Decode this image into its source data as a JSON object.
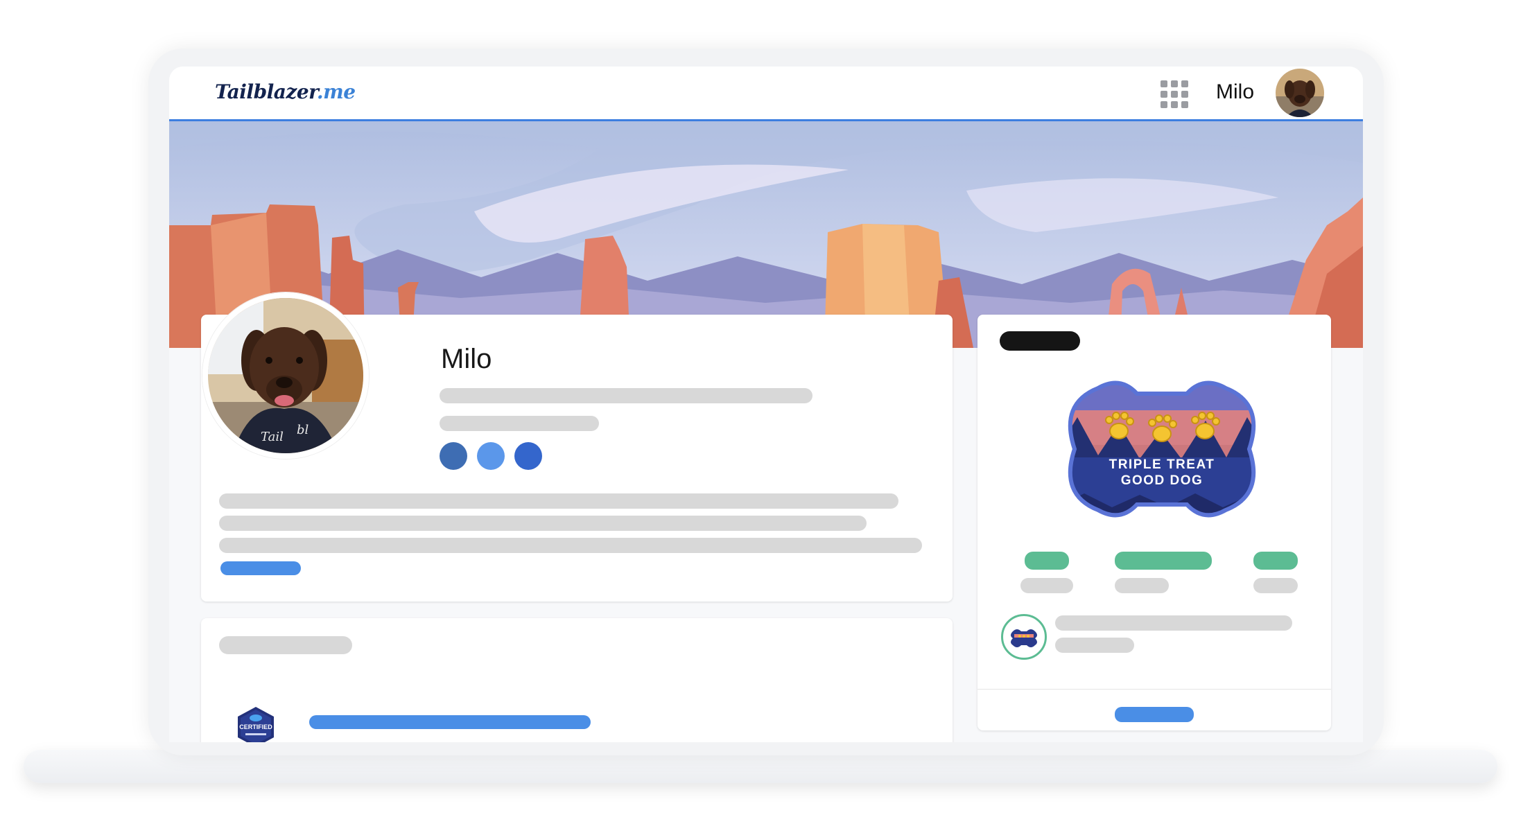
{
  "brand": {
    "logo_main": "Tailblazer",
    "logo_tld": ".me"
  },
  "header": {
    "user_name": "Milo",
    "apps_icon": "app-launcher-grid-icon"
  },
  "profile": {
    "name": "Milo",
    "social_icons": [
      "social-dot-1",
      "social-dot-2",
      "social-dot-3"
    ]
  },
  "featured_badge": {
    "line1": "TRIPLE TREAT",
    "line2": "GOOD DOG"
  },
  "lower_card": {
    "certification_badge_text": "CERTIFIED"
  },
  "colors": {
    "accent": "#3c7ee0",
    "link": "#4a8ee6",
    "success": "#5cbc93",
    "navy": "#13234e"
  }
}
